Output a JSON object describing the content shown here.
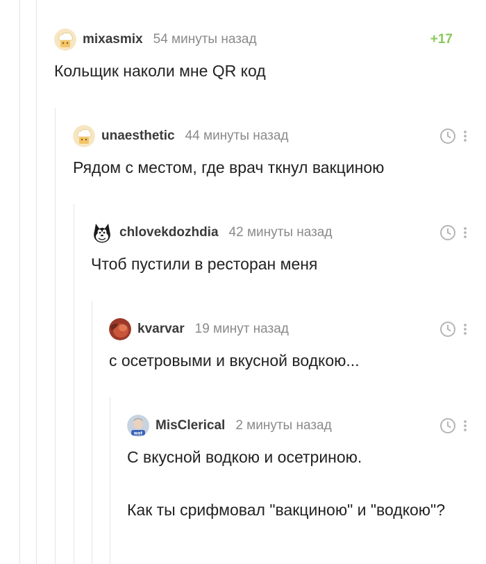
{
  "comments": [
    {
      "username": "mixasmix",
      "time": "54 минуты назад",
      "rating": "+17",
      "avatar_icon": "chef-hat-avatar-icon",
      "text": [
        "Кольщик наколи мне QR код"
      ]
    },
    {
      "username": "unaesthetic",
      "time": "44 минуты назад",
      "avatar_icon": "chef-hat-avatar-icon",
      "text": [
        "Рядом с местом, где врач ткнул вакциною"
      ]
    },
    {
      "username": "chlovekdozhdia",
      "time": "42 минуты назад",
      "avatar_icon": "cartoon-cat-avatar-icon",
      "text": [
        "Чтоб пустили в ресторан меня"
      ]
    },
    {
      "username": "kvarvar",
      "time": "19 минут назад",
      "avatar_icon": "photo-avatar-icon",
      "text": [
        "с осетровыми и вкусной водкою..."
      ]
    },
    {
      "username": "MisClerical",
      "time": "2 минуты назад",
      "avatar_icon": "photo-avatar-icon",
      "text": [
        "С вкусной водкою и осетриною.",
        "Как ты срифмовал \"вакциною\" и \"водкою\"?"
      ]
    }
  ],
  "colors": {
    "rating": "#8ac858",
    "username": "#3a3a3a",
    "timestamp": "#8a8a8a",
    "thread_line": "#e4e4e4",
    "icon_gray": "#b5b5b5"
  }
}
